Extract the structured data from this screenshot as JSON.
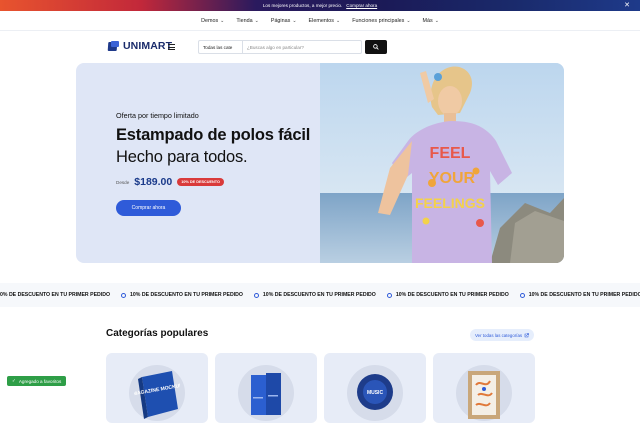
{
  "promo": {
    "text": "Los mejores productos, a mejor precio.",
    "link": "Comprar ahora",
    "close_icon": "close-icon",
    "colors": [
      "#e8542e",
      "#c2283a",
      "#1b1a57",
      "#1e3a8a"
    ]
  },
  "top_nav": [
    {
      "label": "Demos"
    },
    {
      "label": "Tienda"
    },
    {
      "label": "Páginas"
    },
    {
      "label": "Elementos"
    },
    {
      "label": "Funciones principales"
    },
    {
      "label": "Más"
    }
  ],
  "header": {
    "logo_text": "UNIMART",
    "menu_icon": "hamburger-icon",
    "search": {
      "category": "Todas las cate",
      "placeholder": "¿Buscas algo en particular?",
      "button_icon": "search-icon"
    }
  },
  "hero": {
    "eyebrow": "Oferta por tiempo limitado",
    "title": "Estampado de polos fácil",
    "subtitle": "Hecho para todos.",
    "price_prefix": "Desde",
    "price": "$189.00",
    "discount_badge": "10% DE DESCUENTO",
    "cta": "Comprar ahora",
    "image": {
      "shirt_print_line1": "FEEL",
      "shirt_print_line2": "YOUR",
      "shirt_print_line3": "FEELINGS"
    },
    "accent_color": "#2f5bd9"
  },
  "marquee": {
    "text": "10% DE DESCUENTO EN TU PRIMER PEDIDO",
    "partial_text": "0% DE DESCUENTO EN TU PRIMER PEDIDO",
    "icon": "ring-icon"
  },
  "categories": {
    "title": "Categorías populares",
    "see_all": "Ver todas las categorías",
    "see_all_icon": "external-link-icon",
    "items": [
      {
        "name": "mockup-book",
        "cover_text": "MAGAZINE MOCKUP"
      },
      {
        "name": "blue-books"
      },
      {
        "name": "vinyl-record",
        "cover_text": "MUSIC"
      },
      {
        "name": "framed-print"
      }
    ]
  },
  "toast": {
    "text": "Agregado a favoritos",
    "icon": "check-icon",
    "color": "#2e9e47"
  }
}
